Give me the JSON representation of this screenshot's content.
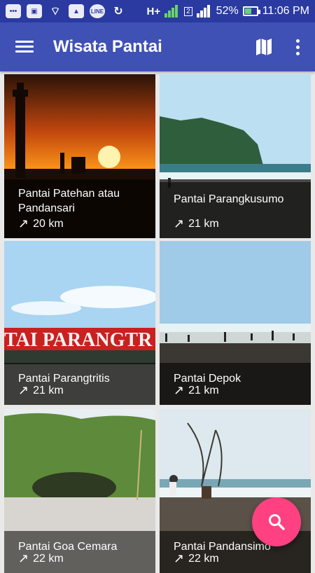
{
  "status_bar": {
    "network_label": "H+",
    "sim2_label": "2",
    "battery": "52%",
    "time": "11:06 PM",
    "app_icons": [
      "message-icon",
      "photo-icon",
      "wifi-call-icon",
      "image-icon",
      "line-icon",
      "sync-icon"
    ]
  },
  "appbar": {
    "title": "Wisata Pantai",
    "color": "#3f51b5",
    "menu_icon": "hamburger-icon",
    "map_icon": "map-icon",
    "more_icon": "more-vert-icon"
  },
  "beaches": [
    {
      "name": "Pantai Patehan atau Pandansari",
      "distance": "20 km"
    },
    {
      "name": "Pantai Parangkusumo",
      "distance": "21 km"
    },
    {
      "name": "Pantai Parangtritis",
      "distance": "21 km"
    },
    {
      "name": "Pantai Depok",
      "distance": "21 km"
    },
    {
      "name": "Pantai Goa Cemara",
      "distance": "22 km"
    },
    {
      "name": "Pantai Pandansimo",
      "distance": "22 km"
    }
  ],
  "sign_text": "TAI PARANGTR",
  "fab": {
    "icon": "search-icon",
    "color": "#ff4081"
  }
}
